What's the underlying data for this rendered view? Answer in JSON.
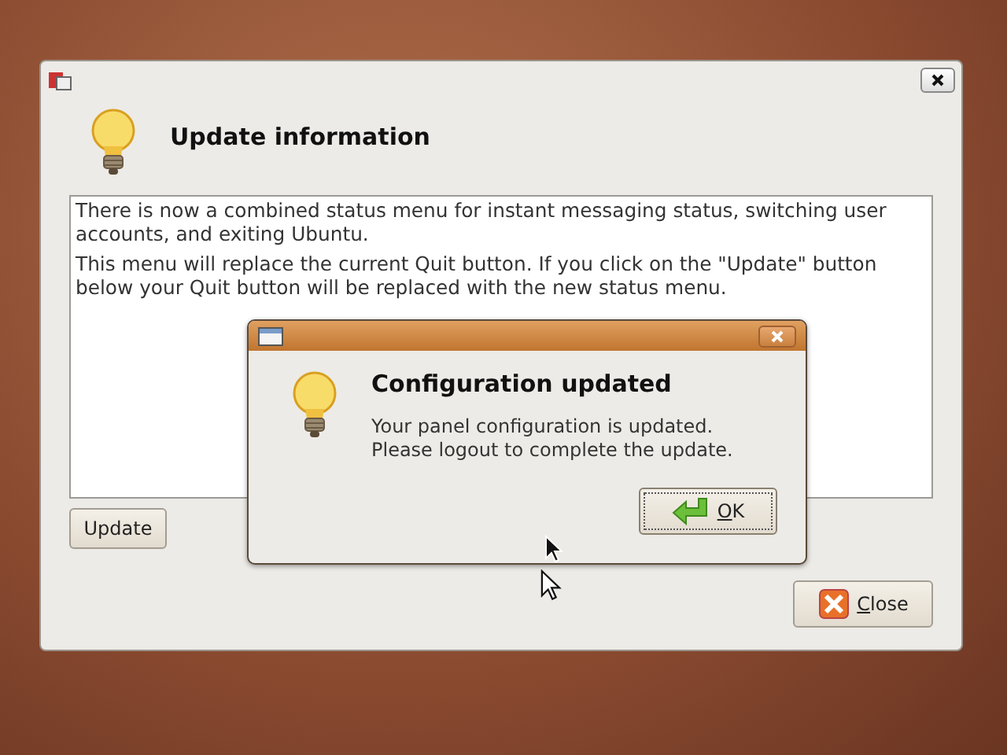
{
  "main_window": {
    "header": "Update information",
    "message": [
      "There is now a combined status menu for instant messaging status, switching user accounts, and exiting Ubuntu.",
      "This menu will replace the current Quit button. If you click on the \"Update\" button below your Quit button will be replaced with the new status menu."
    ],
    "update_button": "Update",
    "close_button": "Close"
  },
  "dialog": {
    "title": "Configuration updated",
    "message": [
      "Your panel configuration is updated.",
      "Please logout to complete the update."
    ],
    "ok_button": "OK",
    "ok_focused": true
  }
}
